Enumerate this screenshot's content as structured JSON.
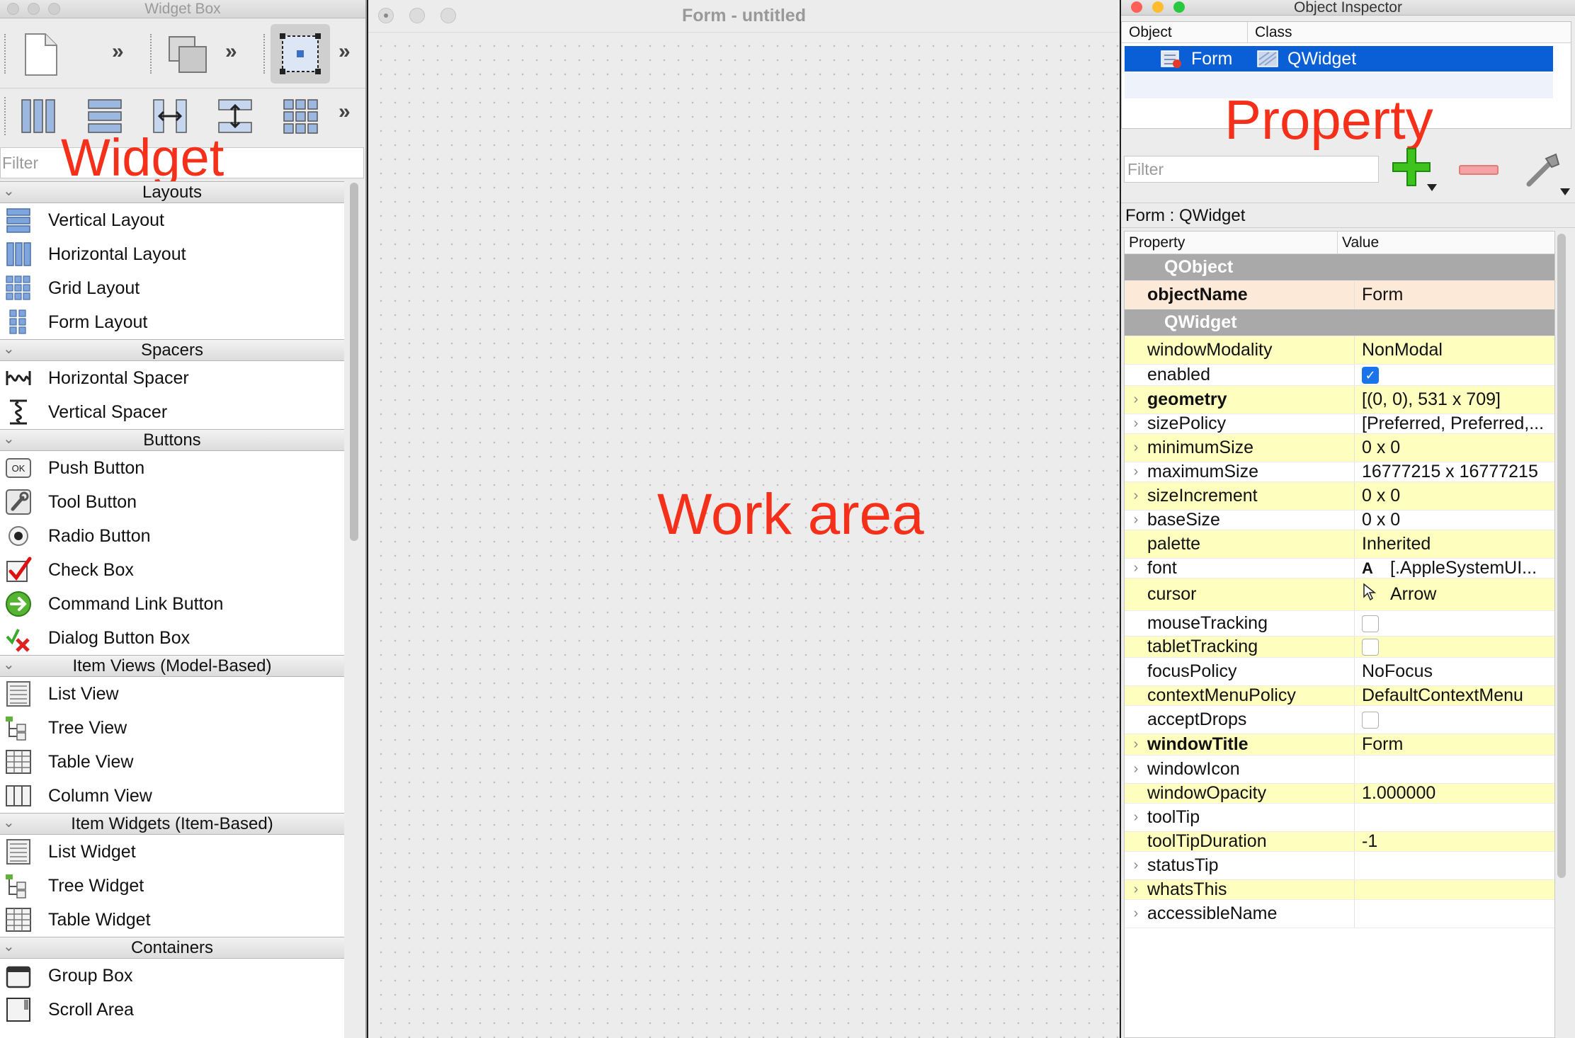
{
  "widget_box": {
    "title": "Widget Box",
    "filter_placeholder": "Filter",
    "overlay_label": "Widget",
    "categories": [
      {
        "name": "Layouts",
        "items": [
          {
            "label": "Vertical Layout",
            "icon": "vertical-layout-icon"
          },
          {
            "label": "Horizontal Layout",
            "icon": "horizontal-layout-icon"
          },
          {
            "label": "Grid Layout",
            "icon": "grid-layout-icon"
          },
          {
            "label": "Form Layout",
            "icon": "form-layout-icon"
          }
        ]
      },
      {
        "name": "Spacers",
        "items": [
          {
            "label": "Horizontal Spacer",
            "icon": "horizontal-spacer-icon"
          },
          {
            "label": "Vertical Spacer",
            "icon": "vertical-spacer-icon"
          }
        ]
      },
      {
        "name": "Buttons",
        "items": [
          {
            "label": "Push Button",
            "icon": "push-button-icon"
          },
          {
            "label": "Tool Button",
            "icon": "tool-button-icon"
          },
          {
            "label": "Radio Button",
            "icon": "radio-button-icon"
          },
          {
            "label": "Check Box",
            "icon": "check-box-icon"
          },
          {
            "label": "Command Link Button",
            "icon": "command-link-icon"
          },
          {
            "label": "Dialog Button Box",
            "icon": "dialog-button-box-icon"
          }
        ]
      },
      {
        "name": "Item Views (Model-Based)",
        "items": [
          {
            "label": "List View",
            "icon": "list-view-icon"
          },
          {
            "label": "Tree View",
            "icon": "tree-view-icon"
          },
          {
            "label": "Table View",
            "icon": "table-view-icon"
          },
          {
            "label": "Column View",
            "icon": "column-view-icon"
          }
        ]
      },
      {
        "name": "Item Widgets (Item-Based)",
        "items": [
          {
            "label": "List Widget",
            "icon": "list-view-icon"
          },
          {
            "label": "Tree Widget",
            "icon": "tree-view-icon"
          },
          {
            "label": "Table Widget",
            "icon": "table-view-icon"
          }
        ]
      },
      {
        "name": "Containers",
        "items": [
          {
            "label": "Group Box",
            "icon": "group-box-icon"
          },
          {
            "label": "Scroll Area",
            "icon": "scroll-area-icon"
          }
        ]
      }
    ],
    "push_button_icon_text": "OK"
  },
  "form_window": {
    "title": "Form - untitled",
    "overlay_label": "Work area"
  },
  "inspector": {
    "title": "Object Inspector",
    "columns": {
      "object": "Object",
      "class": "Class"
    },
    "selected_row": {
      "object": "Form",
      "class": "QWidget"
    },
    "overlay_label": "Property",
    "filter_placeholder": "Filter",
    "class_line": "Form : QWidget",
    "prop_columns": {
      "property": "Property",
      "value": "Value"
    },
    "rows": [
      {
        "type": "group",
        "name": "QObject"
      },
      {
        "type": "prop",
        "name": "objectName",
        "value": "Form",
        "bold": true,
        "bg": "peach",
        "expand": false
      },
      {
        "type": "group",
        "name": "QWidget"
      },
      {
        "type": "prop",
        "name": "windowModality",
        "value": "NonModal",
        "bg": "yellow",
        "expand": false
      },
      {
        "type": "prop",
        "name": "enabled",
        "checkbox": true,
        "checked": true,
        "bg": "white",
        "expand": false
      },
      {
        "type": "prop",
        "name": "geometry",
        "value": "[(0, 0), 531 x 709]",
        "bold": true,
        "bg": "yellow",
        "expand": true
      },
      {
        "type": "prop",
        "name": "sizePolicy",
        "value": "[Preferred, Preferred,...",
        "bg": "white",
        "expand": true
      },
      {
        "type": "prop",
        "name": "minimumSize",
        "value": "0 x 0",
        "bg": "yellow",
        "expand": true
      },
      {
        "type": "prop",
        "name": "maximumSize",
        "value": "16777215 x 16777215",
        "bg": "white",
        "expand": true
      },
      {
        "type": "prop",
        "name": "sizeIncrement",
        "value": "0 x 0",
        "bg": "yellow",
        "expand": true
      },
      {
        "type": "prop",
        "name": "baseSize",
        "value": "0 x 0",
        "bg": "white",
        "expand": true
      },
      {
        "type": "prop",
        "name": "palette",
        "value": "Inherited",
        "bg": "yellow",
        "expand": false
      },
      {
        "type": "prop",
        "name": "font",
        "value": "[.AppleSystemUI...",
        "icon": "font-icon",
        "icon_text": "A",
        "bg": "white",
        "expand": true
      },
      {
        "type": "prop",
        "name": "cursor",
        "value": "Arrow",
        "icon": "cursor-icon",
        "bg": "yellow",
        "expand": false
      },
      {
        "type": "prop",
        "name": "mouseTracking",
        "checkbox": true,
        "checked": false,
        "bg": "white",
        "expand": false
      },
      {
        "type": "prop",
        "name": "tabletTracking",
        "checkbox": true,
        "checked": false,
        "bg": "yellow",
        "expand": false
      },
      {
        "type": "prop",
        "name": "focusPolicy",
        "value": "NoFocus",
        "bg": "white",
        "expand": false
      },
      {
        "type": "prop",
        "name": "contextMenuPolicy",
        "value": "DefaultContextMenu",
        "bg": "yellow",
        "expand": false
      },
      {
        "type": "prop",
        "name": "acceptDrops",
        "checkbox": true,
        "checked": false,
        "bg": "white",
        "expand": false
      },
      {
        "type": "prop",
        "name": "windowTitle",
        "value": "Form",
        "bold": true,
        "bg": "yellow",
        "expand": true
      },
      {
        "type": "prop",
        "name": "windowIcon",
        "value": "",
        "bg": "white",
        "expand": true
      },
      {
        "type": "prop",
        "name": "windowOpacity",
        "value": "1.000000",
        "bg": "yellow",
        "expand": false
      },
      {
        "type": "prop",
        "name": "toolTip",
        "value": "",
        "bg": "white",
        "expand": true
      },
      {
        "type": "prop",
        "name": "toolTipDuration",
        "value": "-1",
        "bg": "yellow",
        "expand": false
      },
      {
        "type": "prop",
        "name": "statusTip",
        "value": "",
        "bg": "white",
        "expand": true
      },
      {
        "type": "prop",
        "name": "whatsThis",
        "value": "",
        "bg": "yellow",
        "expand": true
      },
      {
        "type": "prop",
        "name": "accessibleName",
        "value": "",
        "bg": "white",
        "expand": true
      }
    ]
  },
  "colors": {
    "overlay_red": "#f4301a",
    "selection_blue": "#0a5fd7",
    "prop_yellow": "#fefebe",
    "prop_peach": "#fde9d7",
    "group_gray": "#a9a9a9"
  }
}
